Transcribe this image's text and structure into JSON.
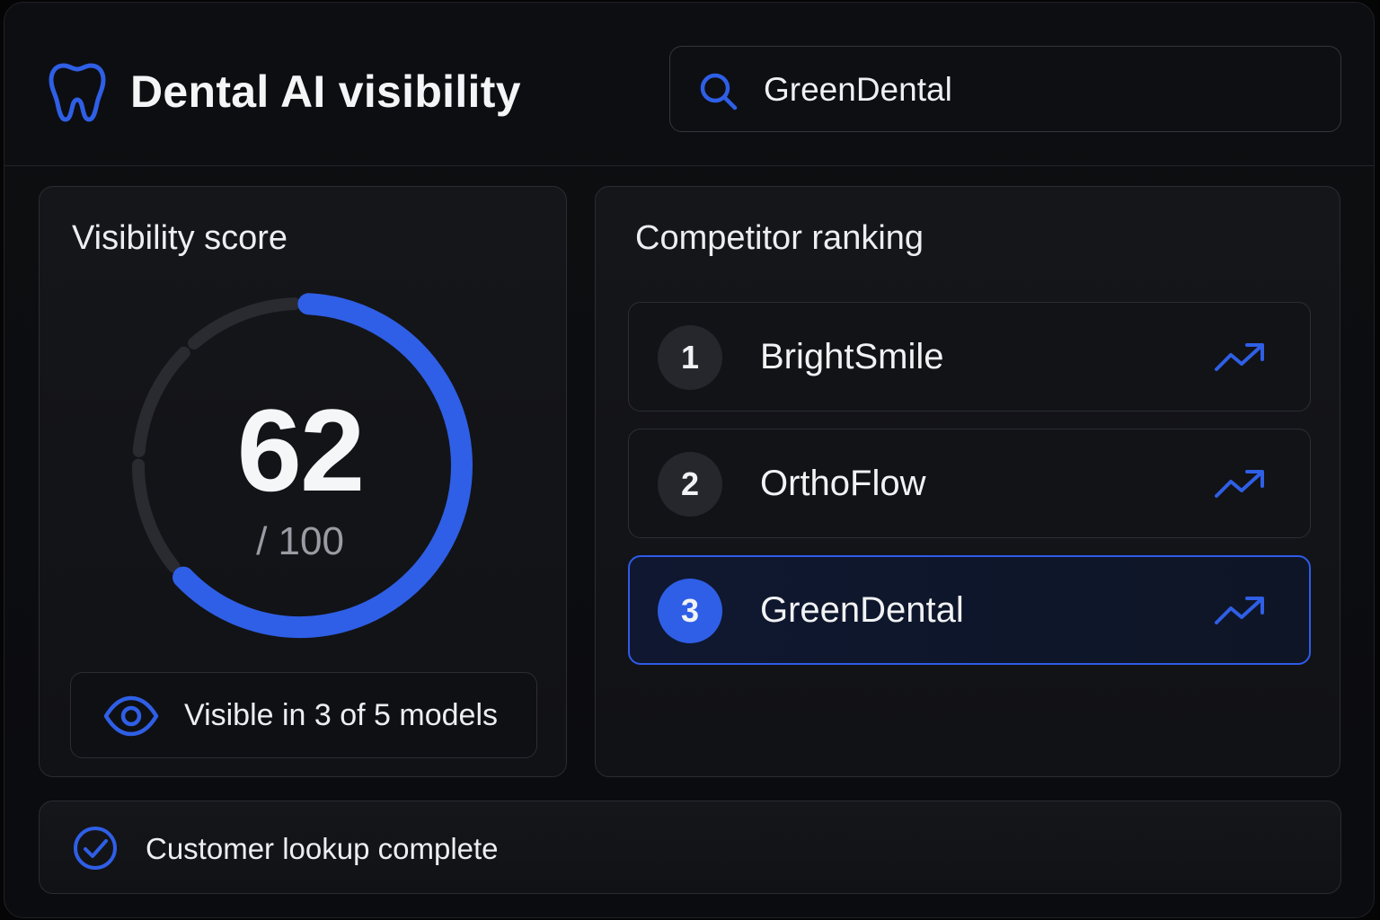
{
  "header": {
    "title": "Dental AI visibility",
    "logo_icon": "tooth-icon",
    "search": {
      "value": "GreenDental",
      "icon": "search-icon"
    }
  },
  "score_card": {
    "title": "Visibility score",
    "score": 62,
    "score_text": "62",
    "max_text": "/ 100",
    "score_fraction": 0.62,
    "models": {
      "text": "Visible in 3 of 5 models",
      "visible": 3,
      "total": 5,
      "icon": "eye-icon"
    }
  },
  "ranking": {
    "title": "Competitor ranking",
    "items": [
      {
        "rank": "1",
        "name": "BrightSmile",
        "icon": "trend-up-icon",
        "active": false
      },
      {
        "rank": "2",
        "name": "OrthoFlow",
        "icon": "trend-up-icon",
        "active": false
      },
      {
        "rank": "3",
        "name": "GreenDental",
        "icon": "trend-up-icon",
        "active": true
      }
    ]
  },
  "status": {
    "text": "Customer lookup complete",
    "icon": "check-circle-icon"
  },
  "colors": {
    "accent": "#2f5fe6",
    "background": "#0b0c0f",
    "card": "#131418",
    "track": "#2a2b30",
    "text": "#f1f2f4",
    "muted": "#9a9ca3"
  }
}
